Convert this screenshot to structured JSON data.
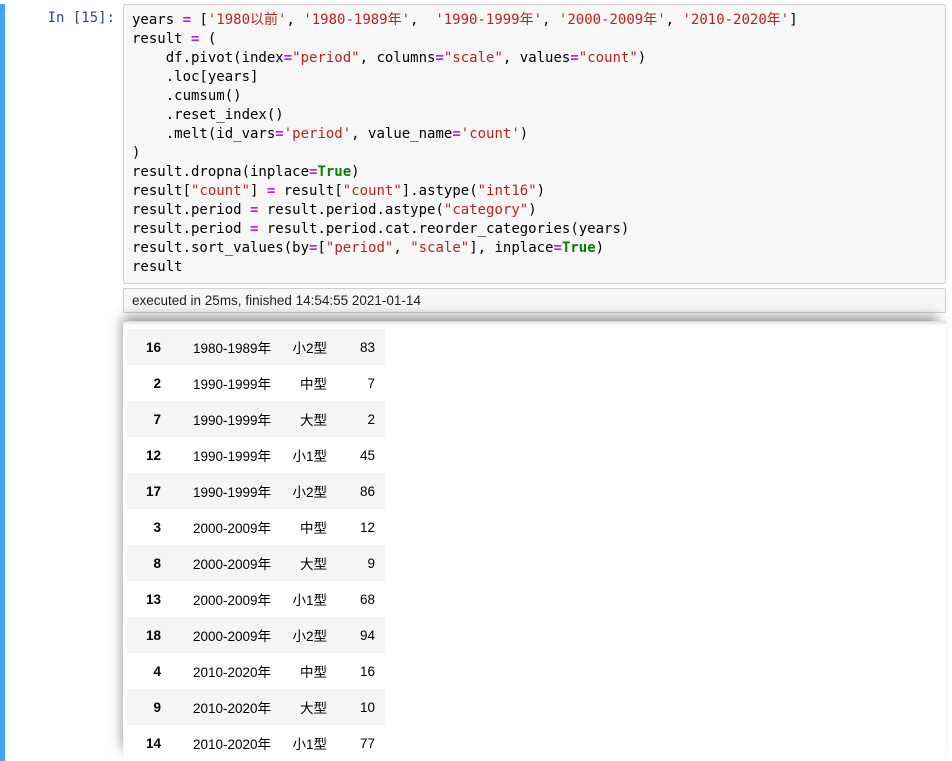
{
  "prompt": {
    "label": "In [15]:"
  },
  "code": {
    "tokens": [
      {
        "t": "n",
        "v": "years "
      },
      {
        "t": "o",
        "v": "="
      },
      {
        "t": "n",
        "v": " ["
      },
      {
        "t": "s",
        "v": "'1980以前'"
      },
      {
        "t": "n",
        "v": ", "
      },
      {
        "t": "s",
        "v": "'1980-1989年'"
      },
      {
        "t": "n",
        "v": ",  "
      },
      {
        "t": "s",
        "v": "'1990-1999年'"
      },
      {
        "t": "n",
        "v": ", "
      },
      {
        "t": "s",
        "v": "'2000-2009年'"
      },
      {
        "t": "n",
        "v": ", "
      },
      {
        "t": "s",
        "v": "'2010-2020年'"
      },
      {
        "t": "n",
        "v": "]\n"
      },
      {
        "t": "n",
        "v": "result "
      },
      {
        "t": "o",
        "v": "="
      },
      {
        "t": "n",
        "v": " (\n"
      },
      {
        "t": "n",
        "v": "    df.pivot(index"
      },
      {
        "t": "o",
        "v": "="
      },
      {
        "t": "s",
        "v": "\"period\""
      },
      {
        "t": "n",
        "v": ", columns"
      },
      {
        "t": "o",
        "v": "="
      },
      {
        "t": "s",
        "v": "\"scale\""
      },
      {
        "t": "n",
        "v": ", values"
      },
      {
        "t": "o",
        "v": "="
      },
      {
        "t": "s",
        "v": "\"count\""
      },
      {
        "t": "n",
        "v": ")\n"
      },
      {
        "t": "n",
        "v": "    .loc[years]\n"
      },
      {
        "t": "n",
        "v": "    .cumsum()\n"
      },
      {
        "t": "n",
        "v": "    .reset_index()\n"
      },
      {
        "t": "n",
        "v": "    .melt(id_vars"
      },
      {
        "t": "o",
        "v": "="
      },
      {
        "t": "s",
        "v": "'period'"
      },
      {
        "t": "n",
        "v": ", value_name"
      },
      {
        "t": "o",
        "v": "="
      },
      {
        "t": "s",
        "v": "'count'"
      },
      {
        "t": "n",
        "v": ")\n"
      },
      {
        "t": "n",
        "v": ")\n"
      },
      {
        "t": "n",
        "v": "result.dropna(inplace"
      },
      {
        "t": "o",
        "v": "="
      },
      {
        "t": "k",
        "v": "True"
      },
      {
        "t": "n",
        "v": ")\n"
      },
      {
        "t": "n",
        "v": "result["
      },
      {
        "t": "s",
        "v": "\"count\""
      },
      {
        "t": "n",
        "v": "] "
      },
      {
        "t": "o",
        "v": "="
      },
      {
        "t": "n",
        "v": " result["
      },
      {
        "t": "s",
        "v": "\"count\""
      },
      {
        "t": "n",
        "v": "].astype("
      },
      {
        "t": "s",
        "v": "\"int16\""
      },
      {
        "t": "n",
        "v": ")\n"
      },
      {
        "t": "n",
        "v": "result.period "
      },
      {
        "t": "o",
        "v": "="
      },
      {
        "t": "n",
        "v": " result.period.astype("
      },
      {
        "t": "s",
        "v": "\"category\""
      },
      {
        "t": "n",
        "v": ")\n"
      },
      {
        "t": "n",
        "v": "result.period "
      },
      {
        "t": "o",
        "v": "="
      },
      {
        "t": "n",
        "v": " result.period.cat.reorder_categories(years)\n"
      },
      {
        "t": "n",
        "v": "result.sort_values(by"
      },
      {
        "t": "o",
        "v": "="
      },
      {
        "t": "n",
        "v": "["
      },
      {
        "t": "s",
        "v": "\"period\""
      },
      {
        "t": "n",
        "v": ", "
      },
      {
        "t": "s",
        "v": "\"scale\""
      },
      {
        "t": "n",
        "v": "], inplace"
      },
      {
        "t": "o",
        "v": "="
      },
      {
        "t": "k",
        "v": "True"
      },
      {
        "t": "n",
        "v": ")\n"
      },
      {
        "t": "n",
        "v": "result"
      }
    ]
  },
  "exec_info": "executed in 25ms, finished 14:54:55 2021-01-14",
  "table": {
    "rows": [
      {
        "idx": "16",
        "period": "1980-1989年",
        "scale": "小2型",
        "count": "83"
      },
      {
        "idx": "2",
        "period": "1990-1999年",
        "scale": "中型",
        "count": "7"
      },
      {
        "idx": "7",
        "period": "1990-1999年",
        "scale": "大型",
        "count": "2"
      },
      {
        "idx": "12",
        "period": "1990-1999年",
        "scale": "小1型",
        "count": "45"
      },
      {
        "idx": "17",
        "period": "1990-1999年",
        "scale": "小2型",
        "count": "86"
      },
      {
        "idx": "3",
        "period": "2000-2009年",
        "scale": "中型",
        "count": "12"
      },
      {
        "idx": "8",
        "period": "2000-2009年",
        "scale": "大型",
        "count": "9"
      },
      {
        "idx": "13",
        "period": "2000-2009年",
        "scale": "小1型",
        "count": "68"
      },
      {
        "idx": "18",
        "period": "2000-2009年",
        "scale": "小2型",
        "count": "94"
      },
      {
        "idx": "4",
        "period": "2010-2020年",
        "scale": "中型",
        "count": "16"
      },
      {
        "idx": "9",
        "period": "2010-2020年",
        "scale": "大型",
        "count": "10"
      },
      {
        "idx": "14",
        "period": "2010-2020年",
        "scale": "小1型",
        "count": "77"
      }
    ]
  }
}
